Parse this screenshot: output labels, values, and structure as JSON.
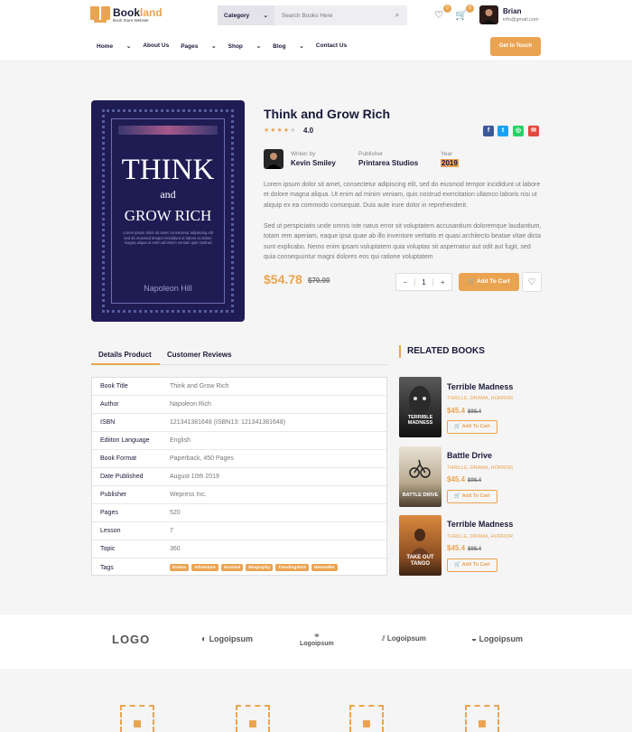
{
  "brand": {
    "name_a": "Book",
    "name_b": "land",
    "tagline": "Book Store Website"
  },
  "search": {
    "category": "Category",
    "placeholder": "Search Books Here"
  },
  "header": {
    "wishlist_count": "0",
    "cart_count": "0",
    "user_name": "Brian",
    "user_email": "info@gmail.com"
  },
  "nav": {
    "items": [
      "Home",
      "About Us",
      "Pages",
      "Shop",
      "Blog",
      "Contact Us"
    ],
    "cta": "Get In Touch"
  },
  "cover": {
    "line1": "THINK",
    "line2": "and",
    "line3": "GROW RICH",
    "blurb": "Lorem ipsum dolor sit amet consectetur adipiscing elit sed do eiusmod tempor incididunt ut labore et dolore magna aliqua ut enim ad minim veniam quis nostrud",
    "author": "Napoleon Hill"
  },
  "product": {
    "title": "Think and Grow Rich",
    "rating": "4.0",
    "stars": 4,
    "writer_label": "Writen by",
    "writer": "Kevin Smiley",
    "publisher_label": "Publisher",
    "publisher": "Printarea Studios",
    "year_label": "Year",
    "year": "2019",
    "desc1": "Lorem ipsum dolor sit amet, consectetur adipiscing elit, sed do eiusmod tempor incididunt ut labore et dolore magna aliqua. Ut enim ad minim veniam, quis nostrud exercitation ullamco laboris nisi ut aliquip ex ea commodo consequat. Duis aute irure dolor in reprehenderit.",
    "desc2": "Sed ut perspiciatis unde omnis iste natus error sit voluptatem accusantium doloremque laudantium, totam rem aperiam, eaque ipsa quae ab illo inventore veritatis et quasi architecto beatae vitae dicta sunt explicabo. Nemo enim ipsam voluptatem quia voluptas sit aspernatur aut odit aut fugit, sed quia consequuntur magni dolores eos qui ratione voluptatem",
    "price": "$54.78",
    "old_price": "$70.00",
    "qty": "1",
    "add_to_cart": "Add To Cart"
  },
  "share": {
    "colors": [
      "#3b5998",
      "#1da1f2",
      "#25d366",
      "#e04a3f"
    ]
  },
  "tabs": {
    "details": "Details Product",
    "reviews": "Customer Reviews"
  },
  "details": [
    {
      "k": "Book Title",
      "v": "Think and Grow Rich"
    },
    {
      "k": "Author",
      "v": "Napoleon Rich"
    },
    {
      "k": "ISBN",
      "v": "121341381648 (ISBN13: 121341381648)"
    },
    {
      "k": "Ediiton Language",
      "v": "English"
    },
    {
      "k": "Book Format",
      "v": "Paperback, 450 Pages"
    },
    {
      "k": "Date Published",
      "v": "August 10th 2019"
    },
    {
      "k": "Publisher",
      "v": "Wepress Inc."
    },
    {
      "k": "Pages",
      "v": "520"
    },
    {
      "k": "Lesson",
      "v": "7"
    },
    {
      "k": "Topic",
      "v": "360"
    },
    {
      "k": "Tags",
      "v": ""
    }
  ],
  "tags": [
    "Drama",
    "Adventure",
    "Survival",
    "Biography",
    "Trending2022",
    "Bestseller"
  ],
  "related": {
    "heading": "RELATED BOOKS",
    "items": [
      {
        "title": "Terrible Madness",
        "genre": "THRILLE, DRAMA, HORROR",
        "price": "$45.4",
        "old": "$98.4",
        "btn": "Add To Cart",
        "cover_text": "TERRIBLE MADNESS"
      },
      {
        "title": "Battle Drive",
        "genre": "THRILLE, DRAMA, HORROR",
        "price": "$45.4",
        "old": "$98.4",
        "btn": "Add To Cart",
        "cover_text": "BATTLE DRIVE"
      },
      {
        "title": "Terrible Madness",
        "genre": "THRILLE, DRAMA, HORROR",
        "price": "$45.4",
        "old": "$98.4",
        "btn": "Add To Cart",
        "cover_text": "TAKE OUT TANGO"
      }
    ]
  },
  "partners": [
    "LOGO",
    "Logoipsum",
    "Logoipsum",
    "Logoipsum",
    "Logoipsum"
  ],
  "accent": "#eaa451",
  "dark": "#1a1a3a"
}
